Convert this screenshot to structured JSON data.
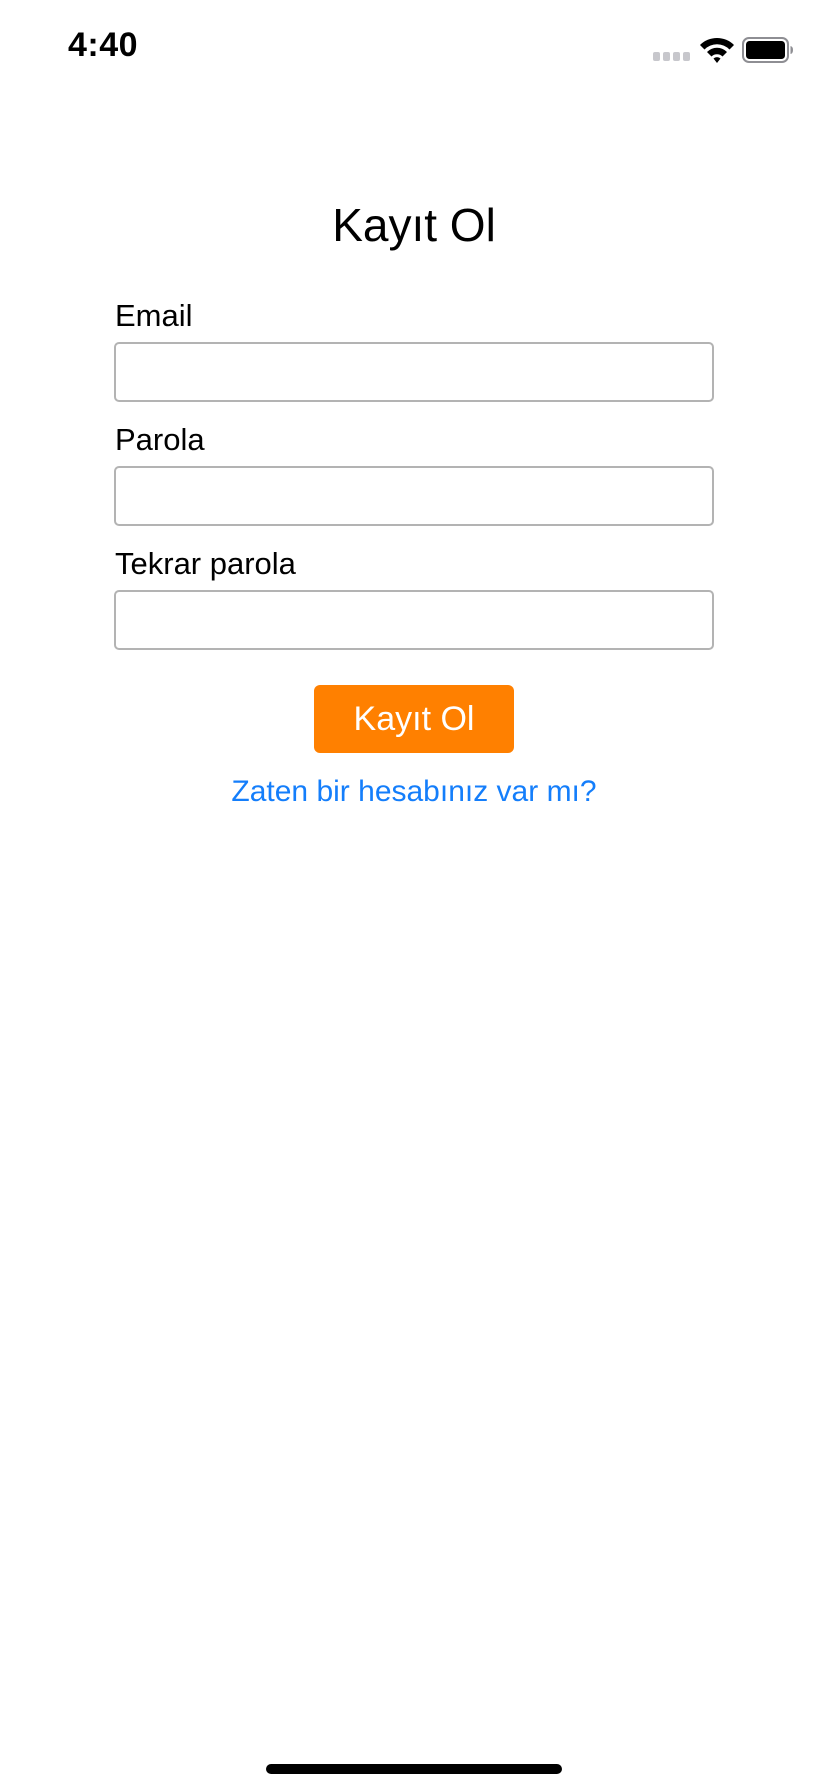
{
  "status_bar": {
    "time": "4:40"
  },
  "form": {
    "title": "Kayıt Ol",
    "fields": [
      {
        "label": "Email",
        "value": "",
        "placeholder": ""
      },
      {
        "label": "Parola",
        "value": "",
        "placeholder": ""
      },
      {
        "label": "Tekrar parola",
        "value": "",
        "placeholder": ""
      }
    ],
    "submit_label": "Kayıt Ol",
    "login_link": "Zaten bir hesabınız var mı?"
  },
  "colors": {
    "accent_orange": "#FF8000",
    "link_blue": "#147EFB"
  }
}
